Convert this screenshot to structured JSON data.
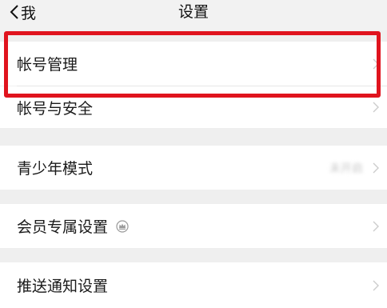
{
  "navbar": {
    "back_label": "我",
    "title": "设置"
  },
  "sections": [
    {
      "items": [
        {
          "label": "帐号管理",
          "value": ""
        },
        {
          "label": "帐号与安全",
          "value": ""
        }
      ]
    },
    {
      "items": [
        {
          "label": "青少年模式",
          "value": "未开启"
        }
      ]
    },
    {
      "items": [
        {
          "label": "会员专属设置",
          "value": ""
        }
      ]
    },
    {
      "items": [
        {
          "label": "推送通知设置",
          "value": ""
        }
      ]
    }
  ],
  "annotation": {
    "highlight_color": "#e0141e"
  },
  "colors": {
    "background": "#f2f2f2",
    "row_bg": "#ffffff",
    "text": "#1a1a1a",
    "chevron": "#cccccc"
  }
}
